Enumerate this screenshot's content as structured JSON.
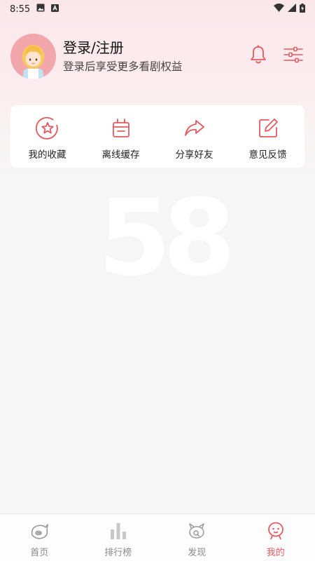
{
  "status_bar": {
    "time": "8:55"
  },
  "profile": {
    "title": "登录/注册",
    "subtitle": "登录后享受更多看剧权益"
  },
  "quick_actions": [
    {
      "label": "我的收藏",
      "icon": "star-icon"
    },
    {
      "label": "离线缓存",
      "icon": "download-box-icon"
    },
    {
      "label": "分享好友",
      "icon": "share-icon"
    },
    {
      "label": "意见反馈",
      "icon": "edit-icon"
    }
  ],
  "watermark": "58",
  "bottom_nav": [
    {
      "label": "首页",
      "icon": "home-icon"
    },
    {
      "label": "排行榜",
      "icon": "ranking-icon"
    },
    {
      "label": "发现",
      "icon": "discover-icon"
    },
    {
      "label": "我的",
      "icon": "mine-icon",
      "active": true
    }
  ],
  "colors": {
    "accent": "#e5595f",
    "header_bg": "#fbe7ea",
    "page_bg": "#f6f6f6"
  }
}
